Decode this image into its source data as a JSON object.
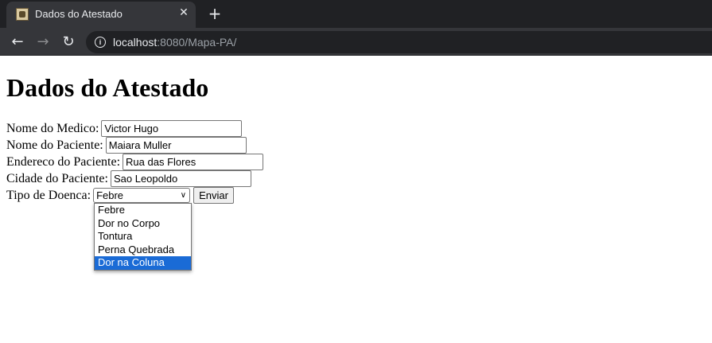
{
  "browser": {
    "tab_title": "Dados do Atestado",
    "tab_close": "✕",
    "new_tab": "+",
    "url_host": "localhost",
    "url_path": ":8080/Mapa-PA/"
  },
  "page": {
    "heading": "Dados do Atestado",
    "fields": [
      {
        "label": "Nome do Medico:",
        "value": "Victor Hugo"
      },
      {
        "label": "Nome do Paciente:",
        "value": "Maiara Muller"
      },
      {
        "label": "Endereco do Paciente:",
        "value": "Rua das Flores"
      },
      {
        "label": "Cidade do Paciente:",
        "value": "Sao Leopoldo"
      }
    ],
    "disease_label": "Tipo de Doenca:",
    "disease_selected": "Febre",
    "submit_label": "Enviar",
    "options": [
      "Febre",
      "Dor no Corpo",
      "Tontura",
      "Perna Quebrada",
      "Dor na Coluna"
    ],
    "highlighted_option": "Dor na Coluna"
  }
}
